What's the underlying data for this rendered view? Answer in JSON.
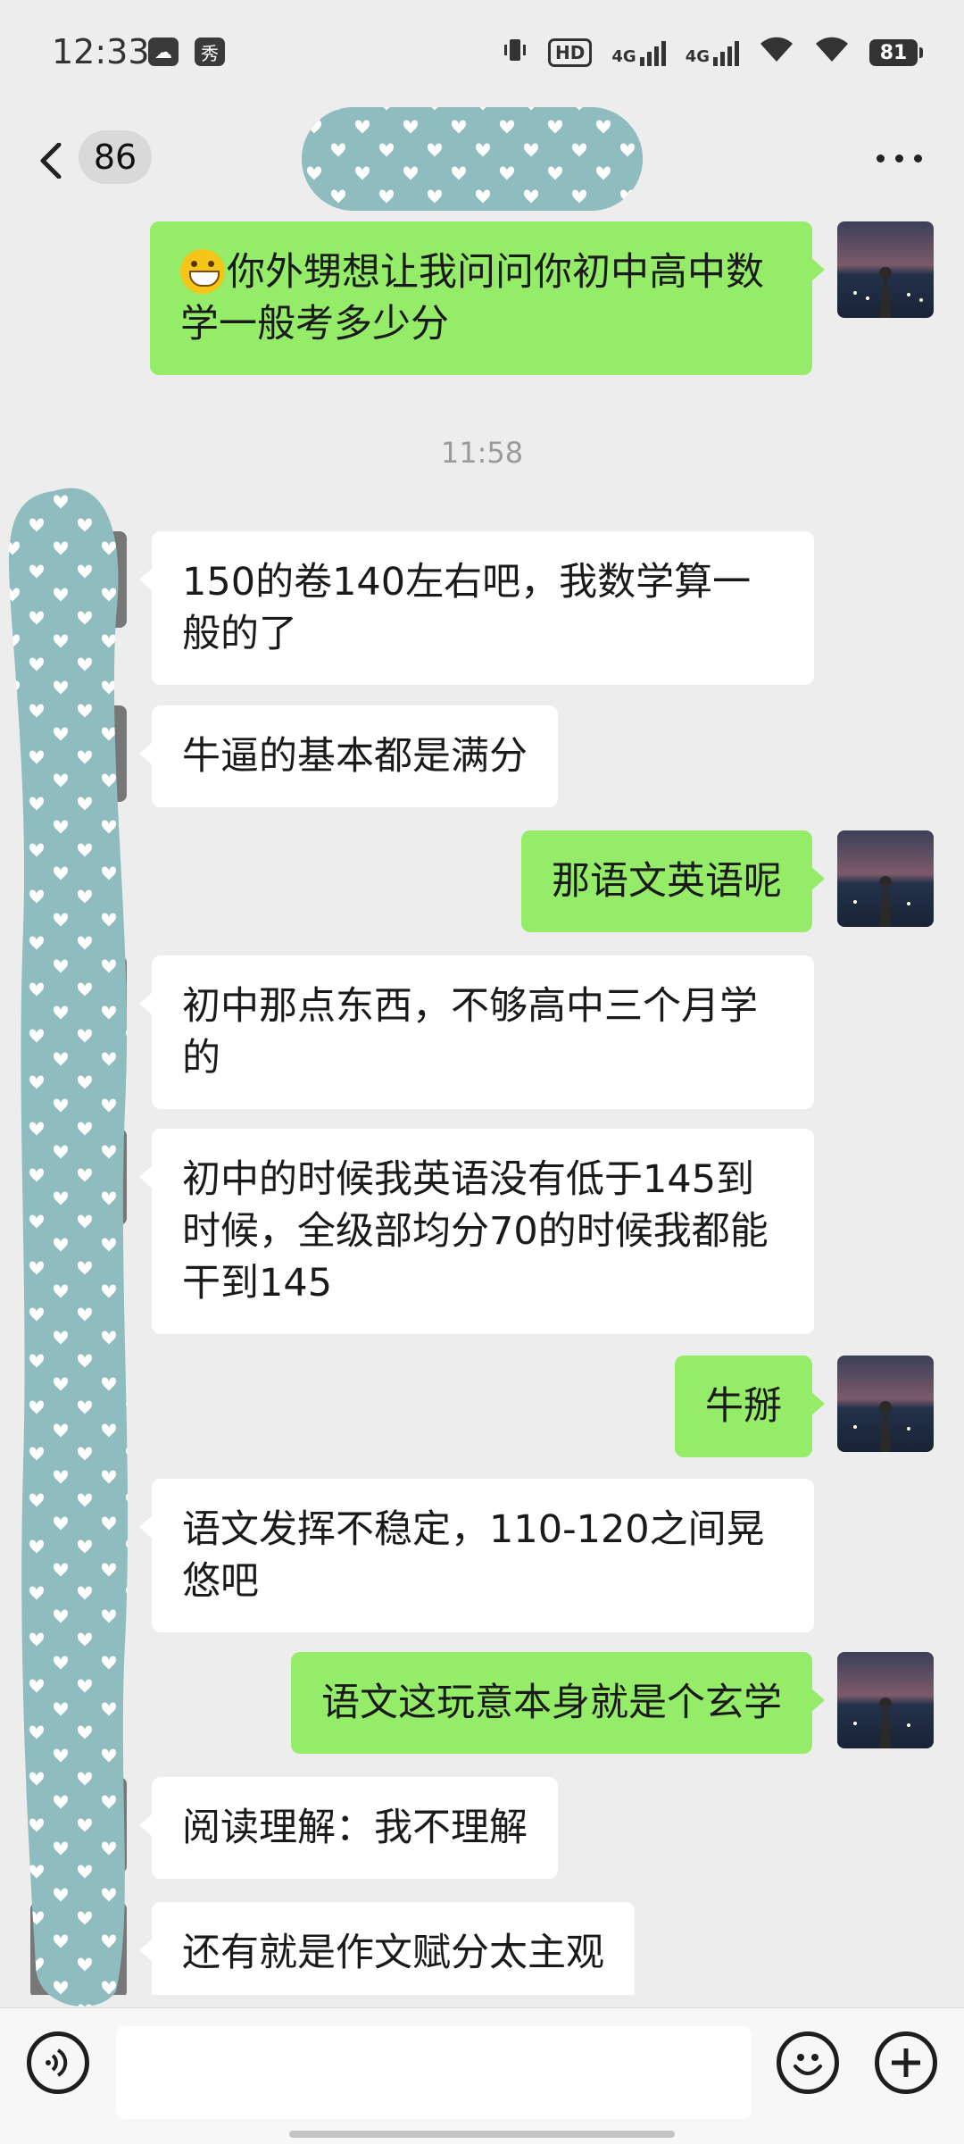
{
  "status_bar": {
    "time": "12:33",
    "chip1": "☁",
    "chip2": "秀",
    "hd": "HD",
    "net1": "4G",
    "net2": "4G",
    "battery": "81"
  },
  "nav": {
    "unread_count": "86",
    "contact_name_hidden": true
  },
  "messages": [
    {
      "side": "me",
      "text": "你外甥想让我问问你初中高中数学一般考多少分",
      "has_emoji": true
    },
    {
      "type": "time",
      "text": "11:58"
    },
    {
      "side": "them",
      "text": "150的卷140左右吧，我数学算一般的了"
    },
    {
      "side": "them",
      "text": "牛逼的基本都是满分"
    },
    {
      "side": "me",
      "text": "那语文英语呢"
    },
    {
      "side": "them",
      "text": "初中那点东西，不够高中三个月学的"
    },
    {
      "side": "them",
      "text": "初中的时候我英语没有低于145到时候，全级部均分70的时候我都能干到145"
    },
    {
      "side": "me",
      "text": "牛掰"
    },
    {
      "side": "them",
      "text": "语文发挥不稳定，110-120之间晃悠吧"
    },
    {
      "side": "me",
      "text": "语文这玩意本身就是个玄学"
    },
    {
      "side": "them",
      "text": "阅读理解：我不理解"
    },
    {
      "side": "them",
      "text": "还有就是作文赋分太主观"
    }
  ],
  "input_bar": {
    "voice_icon": "voice-icon",
    "emoji_icon": "emoji-icon",
    "plus_icon": "plus-icon"
  },
  "colors": {
    "me_bubble": "#95ec69",
    "them_bubble": "#ffffff",
    "background": "#ededed",
    "mask": "#8fbcbf"
  }
}
